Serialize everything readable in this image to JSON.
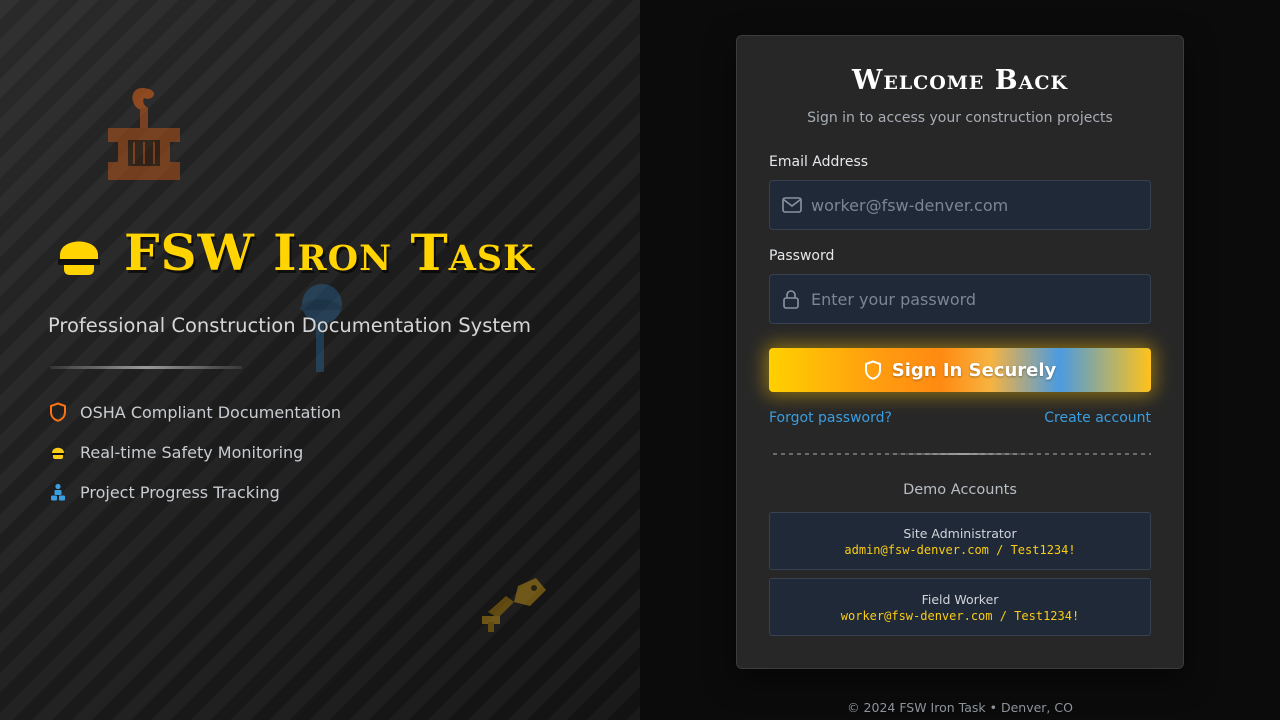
{
  "hero": {
    "title": "FSW Iron Task",
    "subtitle": "Professional Construction Documentation System",
    "features": [
      {
        "icon": "shield-icon",
        "color": "#f97316",
        "label": "OSHA Compliant Documentation"
      },
      {
        "icon": "hard-hat-icon",
        "color": "#facc15",
        "label": "Real-time Safety Monitoring"
      },
      {
        "icon": "people-icon",
        "color": "#3b9ee0",
        "label": "Project Progress Tracking"
      }
    ]
  },
  "login": {
    "title": "Welcome Back",
    "subtitle": "Sign in to access your construction projects",
    "email_label": "Email Address",
    "email_placeholder": "worker@fsw-denver.com",
    "email_value": "",
    "password_label": "Password",
    "password_placeholder": "Enter your password",
    "password_value": "",
    "submit_label": "Sign In Securely",
    "forgot_link": "Forgot password?",
    "create_link": "Create account"
  },
  "demo": {
    "heading": "Demo Accounts",
    "accounts": [
      {
        "role": "Site Administrator",
        "credentials": "admin@fsw-denver.com / Test1234!"
      },
      {
        "role": "Field Worker",
        "credentials": "worker@fsw-denver.com / Test1234!"
      }
    ]
  },
  "footer": {
    "text": "© 2024 FSW Iron Task • Denver, CO"
  },
  "colors": {
    "accent_yellow": "#ffd400",
    "accent_orange": "#f97316",
    "accent_blue": "#3b9ee0",
    "card_bg": "#272727",
    "input_bg": "#1f2937"
  }
}
